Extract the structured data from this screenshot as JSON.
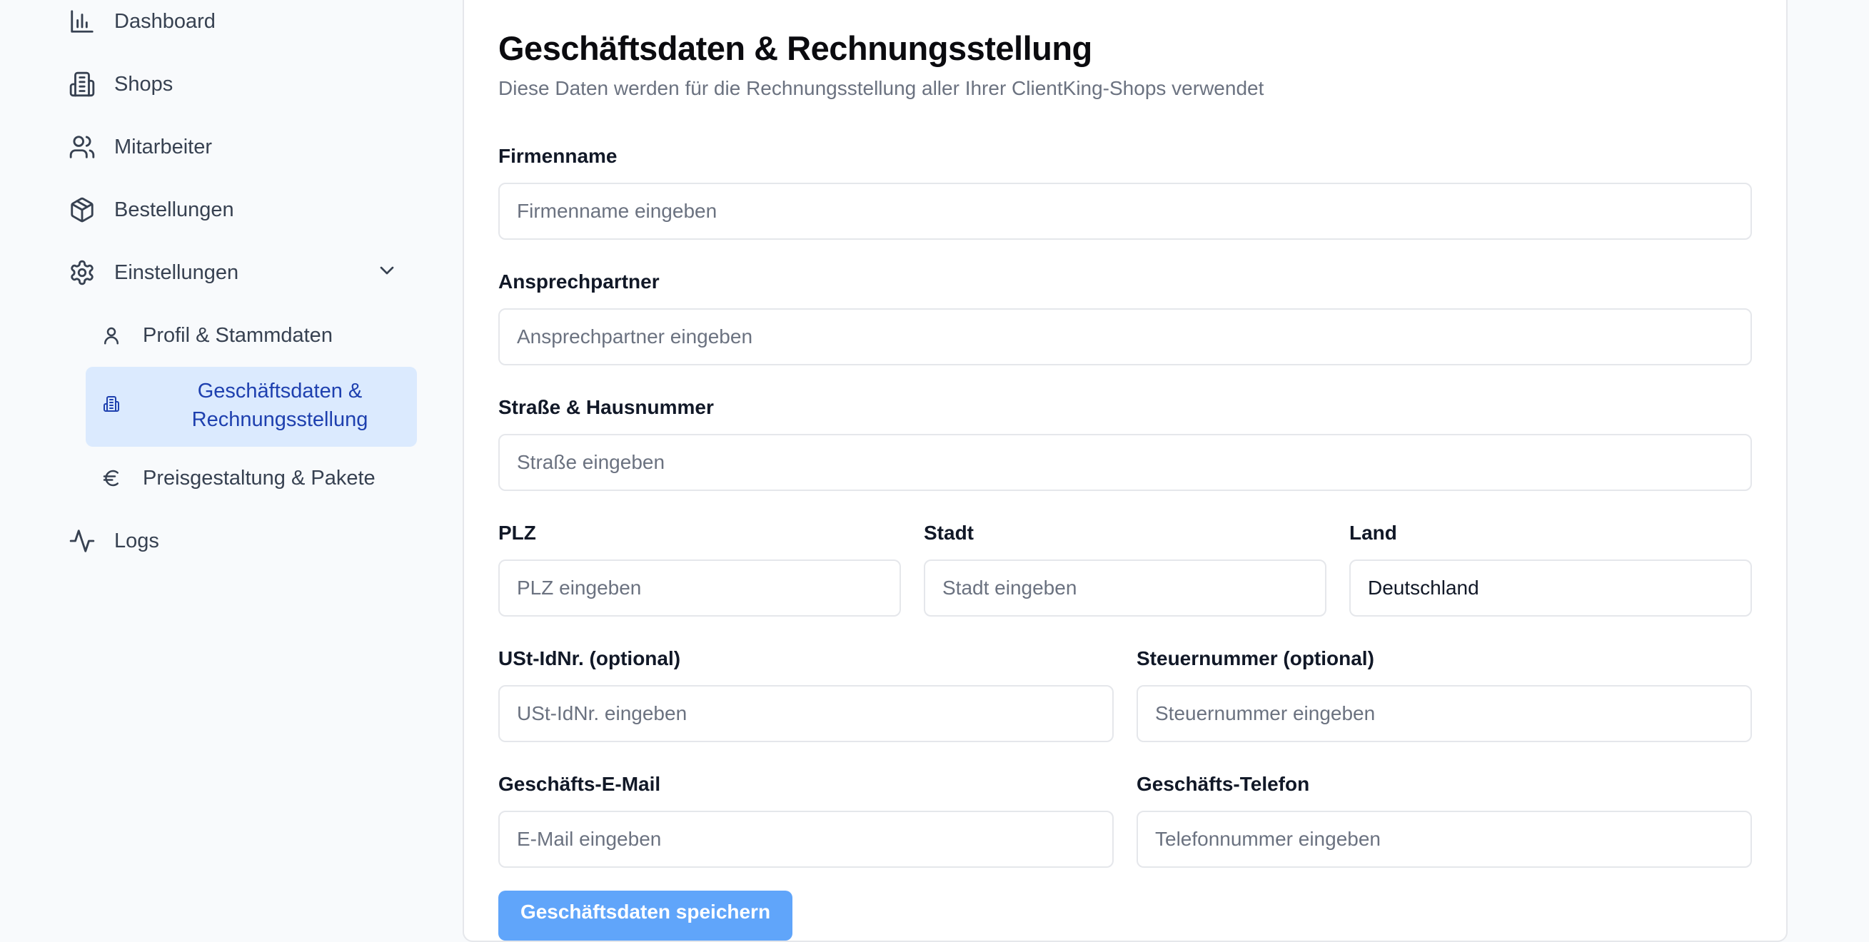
{
  "sidebar": {
    "items": [
      {
        "label": "Dashboard",
        "icon": "bar-chart-icon"
      },
      {
        "label": "Shops",
        "icon": "building-icon"
      },
      {
        "label": "Mitarbeiter",
        "icon": "users-icon"
      },
      {
        "label": "Bestellungen",
        "icon": "package-icon"
      },
      {
        "label": "Einstellungen",
        "icon": "gear-icon"
      },
      {
        "label": "Logs",
        "icon": "activity-icon"
      }
    ],
    "subitems": [
      {
        "label": "Profil & Stammdaten",
        "icon": "user-icon"
      },
      {
        "label": "Geschäftsdaten & Rechnungsstellung",
        "icon": "building-icon",
        "active": true
      },
      {
        "label": "Preisgestaltung & Pakete",
        "icon": "euro-icon"
      }
    ]
  },
  "main": {
    "title": "Geschäftsdaten & Rechnungsstellung",
    "subtitle": "Diese Daten werden für die Rechnungsstellung aller Ihrer ClientKing-Shops verwendet",
    "fields": {
      "firmenname": {
        "label": "Firmenname",
        "placeholder": "Firmenname eingeben",
        "value": ""
      },
      "ansprechpartner": {
        "label": "Ansprechpartner",
        "placeholder": "Ansprechpartner eingeben",
        "value": ""
      },
      "strasse": {
        "label": "Straße & Hausnummer",
        "placeholder": "Straße eingeben",
        "value": ""
      },
      "plz": {
        "label": "PLZ",
        "placeholder": "PLZ eingeben",
        "value": ""
      },
      "stadt": {
        "label": "Stadt",
        "placeholder": "Stadt eingeben",
        "value": ""
      },
      "land": {
        "label": "Land",
        "placeholder": "",
        "value": "Deutschland"
      },
      "ustid": {
        "label": "USt-IdNr. (optional)",
        "placeholder": "USt-IdNr. eingeben",
        "value": ""
      },
      "steuernummer": {
        "label": "Steuernummer (optional)",
        "placeholder": "Steuernummer eingeben",
        "value": ""
      },
      "email": {
        "label": "Geschäfts-E-Mail",
        "placeholder": "E-Mail eingeben",
        "value": ""
      },
      "telefon": {
        "label": "Geschäfts-Telefon",
        "placeholder": "Telefonnummer eingeben",
        "value": ""
      }
    },
    "save_label": "Geschäftsdaten speichern"
  },
  "colors": {
    "accent": "#1e40af",
    "active_bg": "#dbeafe",
    "button": "#60a5fa"
  }
}
